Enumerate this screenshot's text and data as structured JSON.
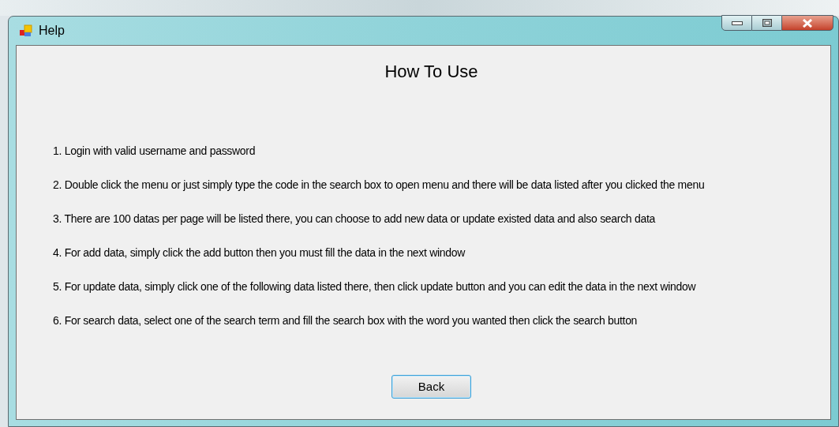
{
  "window": {
    "title": "Help"
  },
  "heading": "How To Use",
  "steps": [
    "1. Login with valid username and password",
    "2. Double click the menu or just simply type the code in the search box to open menu and there will be data listed after you clicked the menu",
    "3. There are 100 datas per page will be listed there, you can choose to add new data or update existed data and also search data",
    "4. For add data, simply click the add button then you must fill the data in the next window",
    "5. For update data, simply click one of the following data listed there, then click update button and you can edit the data in the next window",
    "6. For search data, select one of the search term and fill the search box with the word you wanted then click the search button"
  ],
  "buttons": [
    "Back"
  ]
}
